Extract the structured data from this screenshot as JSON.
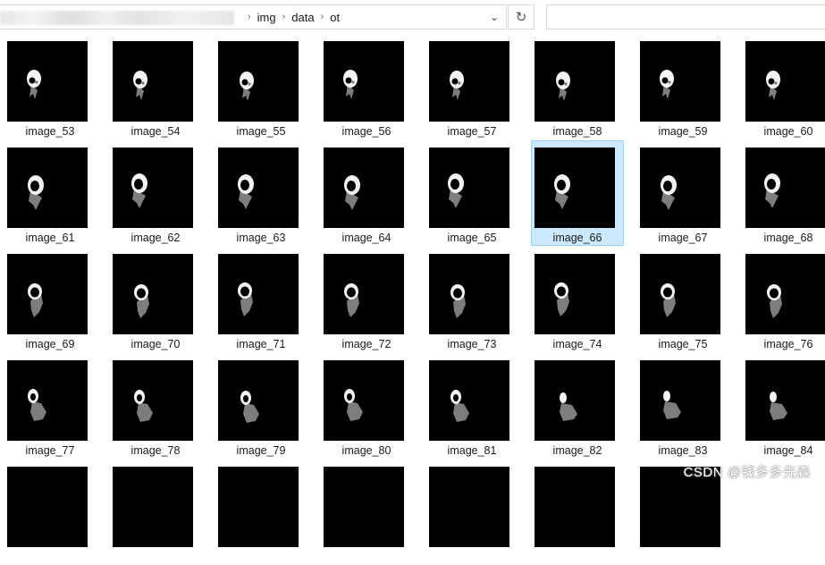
{
  "address_bar": {
    "path": [
      "img",
      "data",
      "ot"
    ]
  },
  "search": {
    "placeholder": ""
  },
  "files": [
    {
      "name": "image_53",
      "stage": 0
    },
    {
      "name": "image_54",
      "stage": 0
    },
    {
      "name": "image_55",
      "stage": 0
    },
    {
      "name": "image_56",
      "stage": 0
    },
    {
      "name": "image_57",
      "stage": 0
    },
    {
      "name": "image_58",
      "stage": 0
    },
    {
      "name": "image_59",
      "stage": 0
    },
    {
      "name": "image_60",
      "stage": 0
    },
    {
      "name": "image_61",
      "stage": 1
    },
    {
      "name": "image_62",
      "stage": 1
    },
    {
      "name": "image_63",
      "stage": 1
    },
    {
      "name": "image_64",
      "stage": 1
    },
    {
      "name": "image_65",
      "stage": 1
    },
    {
      "name": "image_66",
      "stage": 1,
      "selected": true
    },
    {
      "name": "image_67",
      "stage": 1
    },
    {
      "name": "image_68",
      "stage": 1
    },
    {
      "name": "image_69",
      "stage": 2
    },
    {
      "name": "image_70",
      "stage": 2
    },
    {
      "name": "image_71",
      "stage": 2
    },
    {
      "name": "image_72",
      "stage": 2
    },
    {
      "name": "image_73",
      "stage": 2
    },
    {
      "name": "image_74",
      "stage": 2
    },
    {
      "name": "image_75",
      "stage": 2
    },
    {
      "name": "image_76",
      "stage": 2
    },
    {
      "name": "image_77",
      "stage": 3
    },
    {
      "name": "image_78",
      "stage": 3
    },
    {
      "name": "image_79",
      "stage": 3
    },
    {
      "name": "image_80",
      "stage": 3
    },
    {
      "name": "image_81",
      "stage": 3
    },
    {
      "name": "image_82",
      "stage": 4
    },
    {
      "name": "image_83",
      "stage": 4
    },
    {
      "name": "image_84",
      "stage": 4
    }
  ],
  "partial_row_count": 7,
  "watermark": "CSDN @钱多多先森",
  "colors": {
    "selection_bg": "#cce8ff",
    "selection_border": "#99d1ff",
    "thumb_bg": "#000000",
    "seg_white": "#f2f2f2",
    "seg_gray": "#7d7d7d"
  }
}
